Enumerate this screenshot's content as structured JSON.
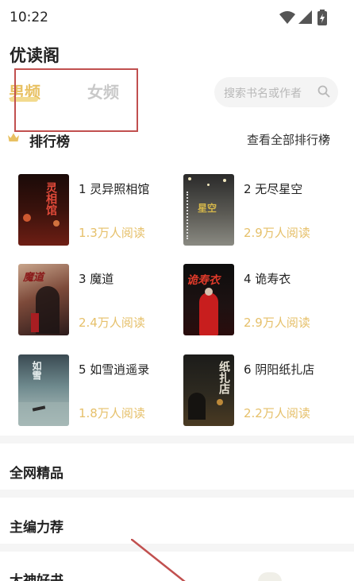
{
  "status_bar": {
    "time": "10:22"
  },
  "app": {
    "title": "优读阁"
  },
  "tabs": [
    {
      "label": "男频",
      "active": true
    },
    {
      "label": "女频",
      "active": false
    }
  ],
  "search": {
    "placeholder": "搜索书名或作者"
  },
  "ranking": {
    "title": "排行榜",
    "see_all": "查看全部排行榜",
    "books": [
      {
        "rank_title": "1 灵异照相馆",
        "reads": "1.3万人阅读",
        "cover_text": "灵相馆"
      },
      {
        "rank_title": "2 无尽星空",
        "reads": "2.9万人阅读",
        "cover_text": "星空"
      },
      {
        "rank_title": "3 魔道",
        "reads": "2.4万人阅读",
        "cover_text": "魔道"
      },
      {
        "rank_title": "4 诡寿衣",
        "reads": "2.9万人阅读",
        "cover_text": "诡寿衣"
      },
      {
        "rank_title": "5 如雪逍遥录",
        "reads": "1.8万人阅读",
        "cover_text": "如雪"
      },
      {
        "rank_title": "6 阴阳纸扎店",
        "reads": "2.2万人阅读",
        "cover_text": "纸扎店"
      }
    ]
  },
  "sections": [
    {
      "title": "全网精品"
    },
    {
      "title": "主编力荐"
    },
    {
      "title": "大神好书"
    }
  ],
  "colors": {
    "accent": "#e8c163",
    "reads": "#e6c06a",
    "annotation": "#c1504f"
  }
}
